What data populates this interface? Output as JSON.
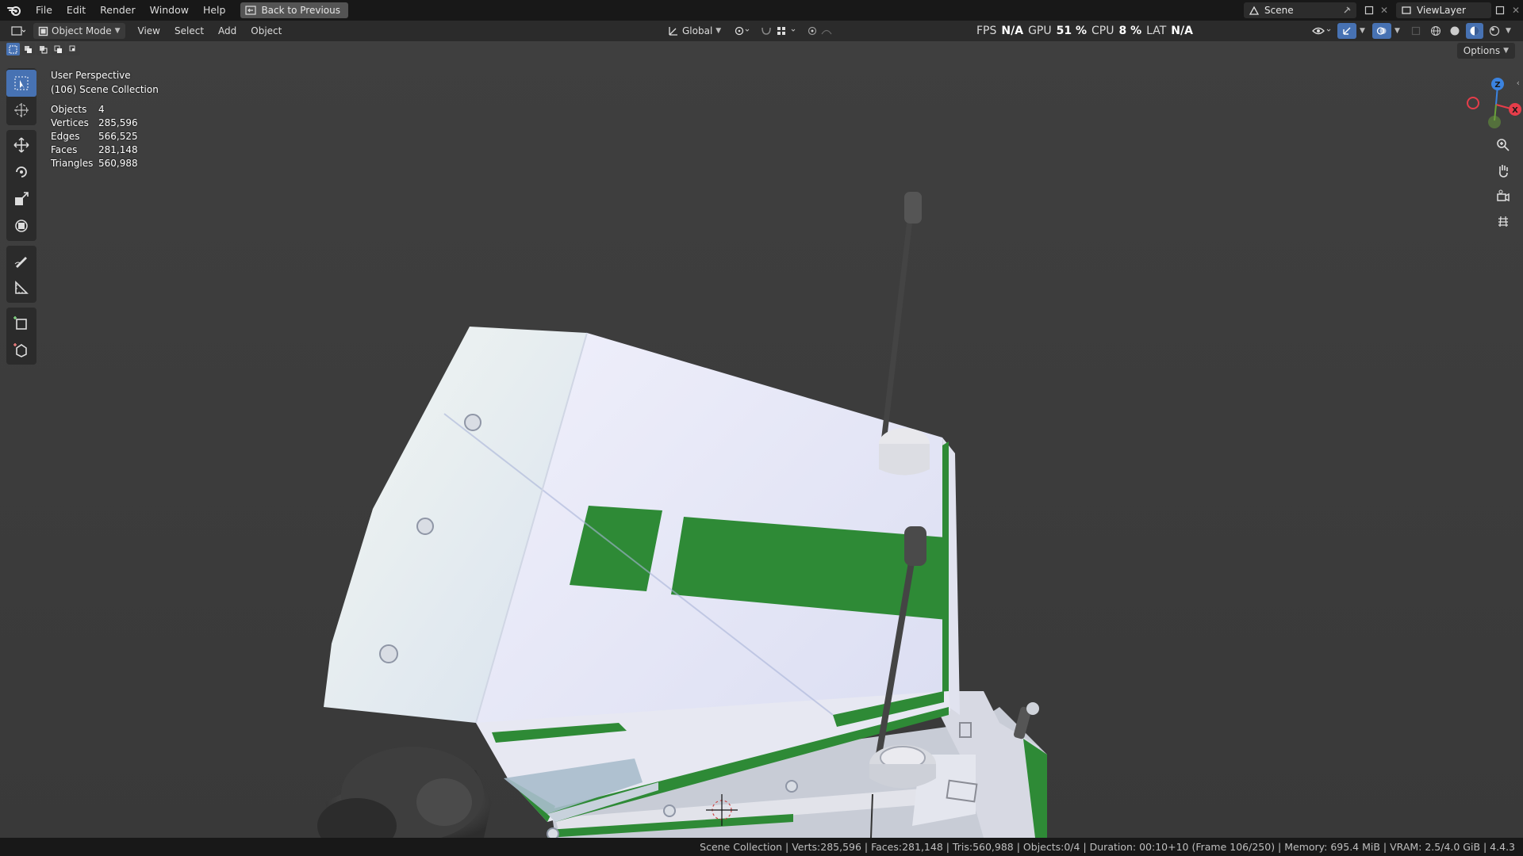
{
  "menubar": {
    "items": [
      "File",
      "Edit",
      "Render",
      "Window",
      "Help"
    ],
    "back_button": "Back to Previous",
    "scene_name": "Scene",
    "view_layer": "ViewLayer"
  },
  "viewport_header": {
    "mode": "Object Mode",
    "menus": [
      "View",
      "Select",
      "Add",
      "Object"
    ],
    "transform_orientation": "Global",
    "perf": {
      "fps_label": "FPS",
      "fps_value": "N/A",
      "gpu_label": "GPU",
      "gpu_value": "51 %",
      "cpu_label": "CPU",
      "cpu_value": "8 %",
      "lat_label": "LAT",
      "lat_value": "N/A"
    },
    "options_label": "Options"
  },
  "overlay": {
    "perspective": "User Perspective",
    "collection": "(106) Scene Collection",
    "stats": [
      {
        "label": "Objects",
        "value": "4"
      },
      {
        "label": "Vertices",
        "value": "285,596"
      },
      {
        "label": "Edges",
        "value": "566,525"
      },
      {
        "label": "Faces",
        "value": "281,148"
      },
      {
        "label": "Triangles",
        "value": "560,988"
      }
    ]
  },
  "gizmo": {
    "axis_z": "Z",
    "axis_x": "X",
    "colors": {
      "x": "#e63d4a",
      "y": "#6aa23b",
      "z": "#3b83e0"
    }
  },
  "statusbar": {
    "text": "Scene Collection | Verts:285,596 | Faces:281,148 | Tris:560,988 | Objects:0/4 | Duration: 00:10+10 (Frame 106/250) | Memory: 695.4 MiB | VRAM: 2.5/4.0 GiB | 4.4.3"
  },
  "colors": {
    "accent": "#4772b3",
    "viewport_bg": "#3d3d3d",
    "model_white": "#e8e8f4",
    "model_green": "#2e8a36"
  }
}
